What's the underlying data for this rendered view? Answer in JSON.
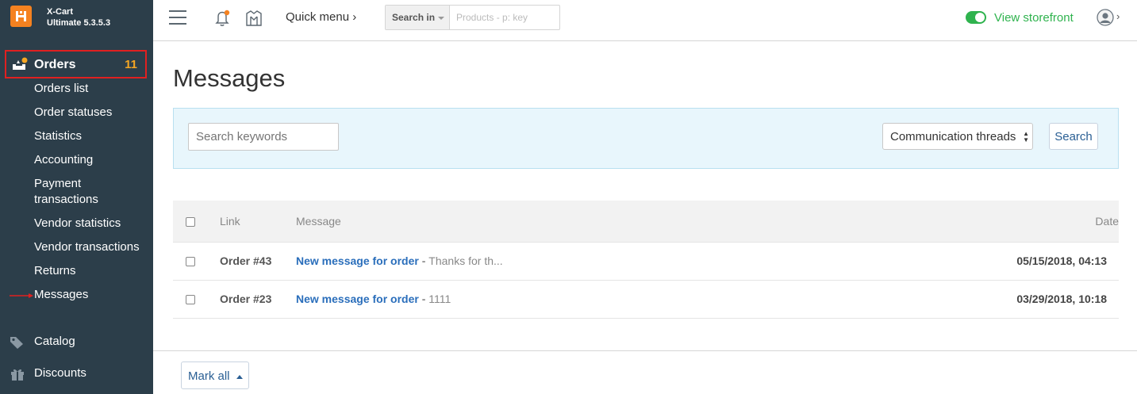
{
  "brand": {
    "name_line1": "X-Cart",
    "name_line2": "Ultimate 5.3.5.3"
  },
  "sidebar": {
    "orders": {
      "label": "Orders",
      "count": "11"
    },
    "sub_items": [
      {
        "label": "Orders list"
      },
      {
        "label": "Order statuses"
      },
      {
        "label": "Statistics"
      },
      {
        "label": "Accounting"
      },
      {
        "label": "Payment"
      },
      {
        "label": "transactions"
      },
      {
        "label": "Vendor statistics"
      },
      {
        "label": "Vendor transactions"
      },
      {
        "label": "Returns"
      },
      {
        "label": "Messages"
      }
    ],
    "main_items": [
      {
        "label": "Catalog",
        "icon": "tags-icon"
      },
      {
        "label": "Discounts",
        "icon": "gift-icon"
      }
    ]
  },
  "topbar": {
    "quick_menu": "Quick menu ›",
    "search_in": "Search in",
    "search_placeholder": "Products - p: key",
    "view_storefront": "View storefront"
  },
  "page": {
    "title": "Messages"
  },
  "filter": {
    "keywords_placeholder": "Search keywords",
    "thread_select": "Communication threads",
    "search_button": "Search"
  },
  "table": {
    "headers": {
      "link": "Link",
      "message": "Message",
      "date": "Date"
    },
    "rows": [
      {
        "link": "Order #43",
        "subject": "New message for order",
        "separator": " - ",
        "body": "Thanks for th...",
        "date": "05/15/2018, 04:13"
      },
      {
        "link": "Order #23",
        "subject": "New message for order",
        "separator": " - ",
        "body": "1111",
        "date": "03/29/2018, 10:18"
      }
    ]
  },
  "footer": {
    "mark_all": "Mark all"
  },
  "colors": {
    "sidebar_bg": "#2c3e4a",
    "accent_orange": "#f58220",
    "link_blue": "#2a6ebb",
    "storefront_green": "#2fb34e",
    "highlight_red": "#e02020"
  }
}
